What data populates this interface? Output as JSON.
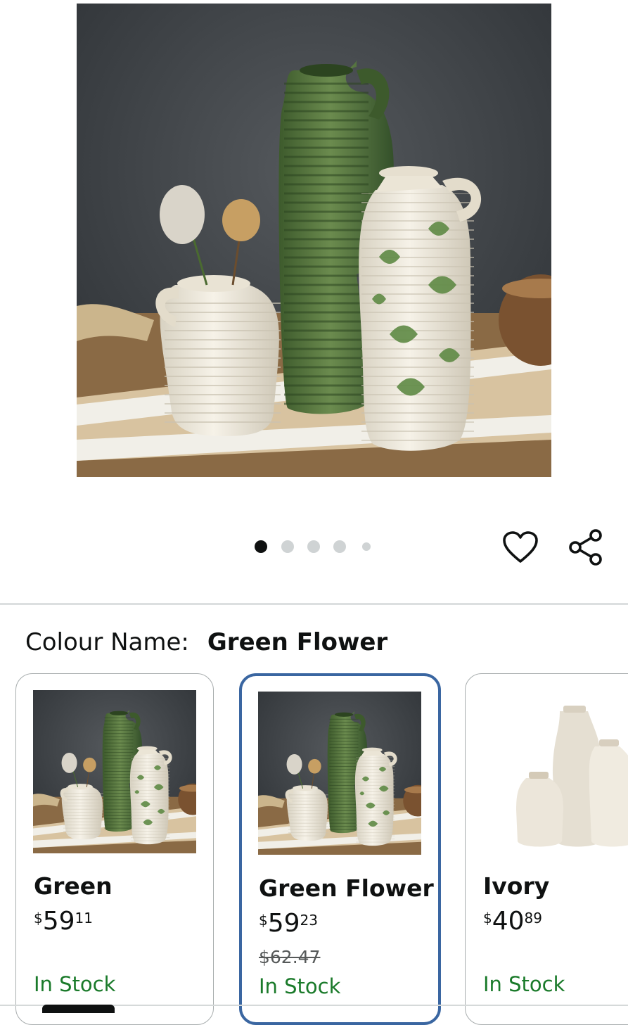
{
  "gallery": {
    "image_alt": "Three ceramic vases: green ribbed jug, ivory small jug with dried flowers, ivory jug with green floral pattern",
    "dot_count": 5,
    "active_dot": 0
  },
  "actions": {
    "wishlist_icon": "heart-icon",
    "share_icon": "share-icon"
  },
  "colour": {
    "label": "Colour Name:",
    "selected": "Green Flower"
  },
  "variants": [
    {
      "name": "Green",
      "currency": "$",
      "whole": "59",
      "fraction": "11",
      "list_price": "",
      "stock": "In Stock",
      "selected": false
    },
    {
      "name": "Green Flower",
      "currency": "$",
      "whole": "59",
      "fraction": "23",
      "list_price": "$62.47",
      "stock": "In Stock",
      "selected": true
    },
    {
      "name": "Ivory",
      "currency": "$",
      "whole": "40",
      "fraction": "89",
      "list_price": "",
      "stock": "In Stock",
      "selected": false
    }
  ],
  "colors": {
    "stock_green": "#1a7a2a",
    "selected_border": "#3a66a1",
    "vase_green": "#4f6f3a",
    "ivory": "#ece6d8"
  }
}
